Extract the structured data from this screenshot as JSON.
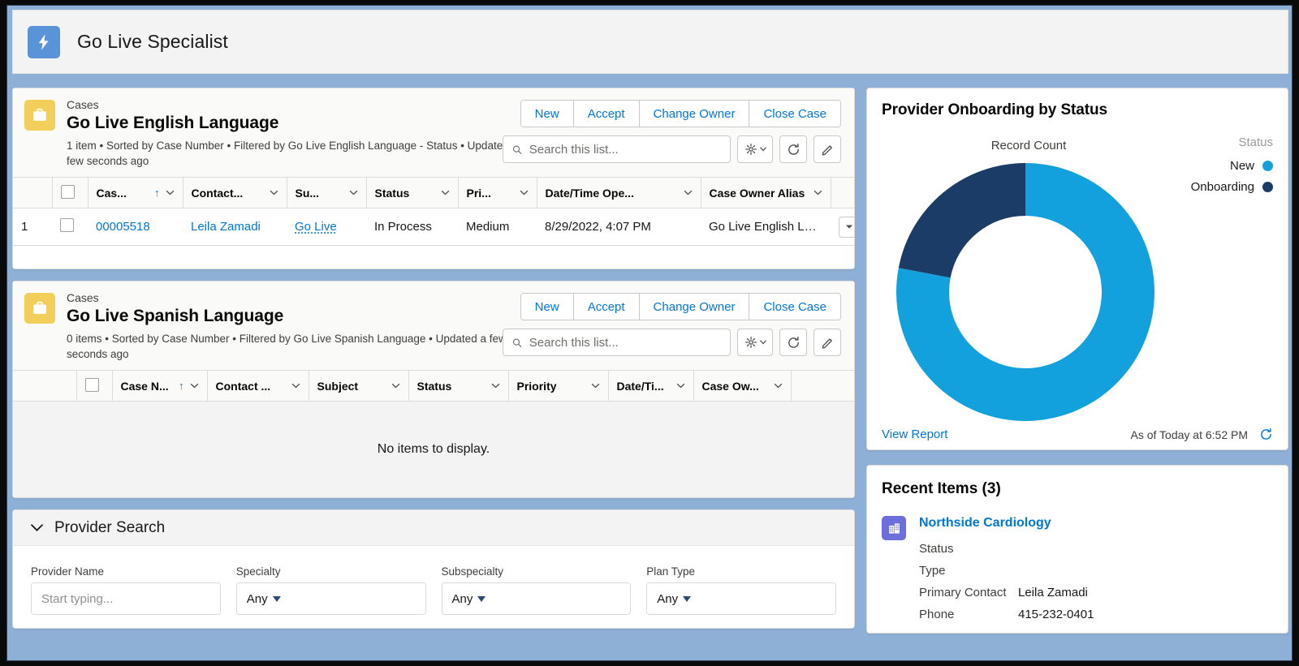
{
  "app": {
    "title": "Go Live Specialist",
    "icon": "lightning-bolt-icon"
  },
  "list_views": [
    {
      "object_label": "Cases",
      "name": "Go Live English Language",
      "meta": "1 item • Sorted by Case Number • Filtered by Go Live English Language - Status • Updated a few seconds ago",
      "icon": "briefcase-icon",
      "actions": [
        "New",
        "Accept",
        "Change Owner",
        "Close Case"
      ],
      "search_placeholder": "Search this list...",
      "search_value": "",
      "columns": [
        "Cas...",
        "Contact...",
        "Su...",
        "Status",
        "Pri...",
        "Date/Time Ope...",
        "Case Owner Alias"
      ],
      "sorted_column_index": 0,
      "sort_direction": "↑",
      "rows": [
        {
          "number": "1",
          "case_number": "00005518",
          "contact_name": "Leila Zamadi",
          "subject": "Go Live",
          "status": "In Process",
          "priority": "Medium",
          "date_time_opened": "8/29/2022, 4:07 PM",
          "case_owner_alias": "Go Live English Language"
        }
      ],
      "empty_text": ""
    },
    {
      "object_label": "Cases",
      "name": "Go Live Spanish Language",
      "meta": "0 items • Sorted by Case Number • Filtered by Go Live Spanish Language • Updated a few seconds ago",
      "icon": "briefcase-icon",
      "actions": [
        "New",
        "Accept",
        "Change Owner",
        "Close Case"
      ],
      "search_placeholder": "Search this list...",
      "search_value": "",
      "columns": [
        "Case N...",
        "Contact ...",
        "Subject",
        "Status",
        "Priority",
        "Date/Ti...",
        "Case Ow..."
      ],
      "sorted_column_index": 0,
      "sort_direction": "↑",
      "rows": [],
      "empty_text": "No items to display."
    }
  ],
  "provider_search": {
    "section_title": "Provider Search",
    "collapse_icon": "chevron-down-icon",
    "fields": [
      {
        "label": "Provider Name",
        "type": "text",
        "value": "",
        "placeholder": "Start typing..."
      },
      {
        "label": "Specialty",
        "type": "select",
        "value": "Any"
      },
      {
        "label": "Subspecialty",
        "type": "select",
        "value": "Any"
      },
      {
        "label": "Plan Type",
        "type": "select",
        "value": "Any"
      }
    ]
  },
  "chart_panel": {
    "title": "Provider Onboarding by Status",
    "view_report_label": "View Report",
    "as_of_label": "As of Today at 6:52 PM",
    "refresh_icon": "refresh-icon"
  },
  "chart_data": {
    "type": "pie",
    "title": "Provider Onboarding by Status",
    "subtitle": "Record Count",
    "measure": "Record Count",
    "legend_title": "Status",
    "legend_position": "right",
    "donut": true,
    "categories": [
      "New",
      "Onboarding"
    ],
    "values": [
      78,
      22
    ],
    "percentages": [
      78,
      22
    ],
    "colors": [
      "#13a1dd",
      "#1b3c66"
    ],
    "start_angle_deg": 0,
    "direction": "clockwise"
  },
  "recent_items": {
    "title": "Recent Items (3)",
    "items": [
      {
        "icon": "building-icon",
        "name": "Northside Cardiology",
        "fields": [
          {
            "key": "Status",
            "value": ""
          },
          {
            "key": "Type",
            "value": ""
          },
          {
            "key": "Primary Contact",
            "value": "Leila Zamadi"
          },
          {
            "key": "Phone",
            "value": "415-232-0401"
          }
        ]
      }
    ]
  },
  "colors": {
    "brand_blue": "#0176d3",
    "chart_new": "#13a1dd",
    "chart_onboarding": "#1b3c66",
    "case_icon": "#f2cf5b",
    "app_icon": "#5a93d8",
    "account_icon": "#6c6fdb",
    "background": "#8fb0d6"
  }
}
